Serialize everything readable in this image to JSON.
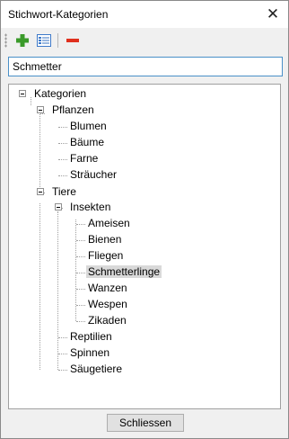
{
  "window": {
    "title": "Stichwort-Kategorien",
    "close_glyph": "✕"
  },
  "toolbar": {
    "buttons": [
      {
        "name": "add-icon",
        "color": "#3a9a2a"
      },
      {
        "name": "edit-properties-icon",
        "color": "#3d79c9"
      },
      {
        "name": "delete-icon",
        "color": "#e0301e"
      }
    ]
  },
  "search": {
    "value": "Schmetter",
    "placeholder": ""
  },
  "tree": {
    "nodes": [
      {
        "label": "Kategorien"
      },
      {
        "label": "Pflanzen"
      },
      {
        "label": "Blumen"
      },
      {
        "label": "Bäume"
      },
      {
        "label": "Farne"
      },
      {
        "label": "Sträucher"
      },
      {
        "label": "Tiere"
      },
      {
        "label": "Insekten"
      },
      {
        "label": "Ameisen"
      },
      {
        "label": "Bienen"
      },
      {
        "label": "Fliegen"
      },
      {
        "label": "Schmetterlinge",
        "selected": true
      },
      {
        "label": "Wanzen"
      },
      {
        "label": "Wespen"
      },
      {
        "label": "Zikaden"
      },
      {
        "label": "Reptilien"
      },
      {
        "label": "Spinnen"
      },
      {
        "label": "Säugetiere"
      }
    ]
  },
  "footer": {
    "close_button": "Schliessen"
  }
}
